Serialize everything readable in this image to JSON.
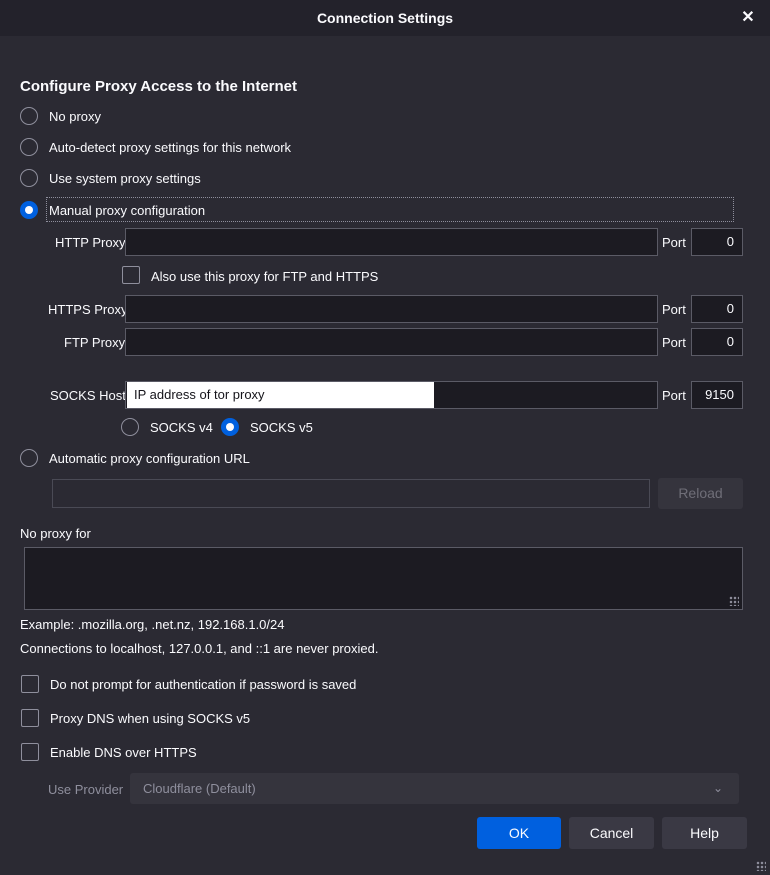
{
  "window": {
    "title": "Connection Settings",
    "close_glyph": "✕"
  },
  "section_heading": "Configure Proxy Access to the Internet",
  "proxy_modes": {
    "no_proxy": "No proxy",
    "auto_detect": "Auto-detect proxy settings for this network",
    "system": "Use system proxy settings",
    "manual": "Manual proxy configuration",
    "auto_url": "Automatic proxy configuration URL",
    "selected": "manual"
  },
  "manual": {
    "http_label": "HTTP Proxy",
    "http_value": "",
    "http_port_label": "Port",
    "http_port": "0",
    "also_use_label": "Also use this proxy for FTP and HTTPS",
    "https_label": "HTTPS Proxy",
    "https_value": "",
    "https_port_label": "Port",
    "https_port": "0",
    "ftp_label": "FTP Proxy",
    "ftp_value": "",
    "ftp_port_label": "Port",
    "ftp_port": "0",
    "socks_label": "SOCKS Host",
    "socks_value": "IP address of tor proxy",
    "socks_port_label": "Port",
    "socks_port": "9150",
    "socks_v4": "SOCKS v4",
    "socks_v5": "SOCKS v5",
    "socks_selected": "v5"
  },
  "auto_url": {
    "value": "",
    "reload_label": "Reload"
  },
  "no_proxy_for": {
    "label": "No proxy for",
    "value": "",
    "example": "Example: .mozilla.org, .net.nz, 192.168.1.0/24",
    "note": "Connections to localhost, 127.0.0.1, and ::1 are never proxied."
  },
  "options": {
    "no_prompt_auth": "Do not prompt for authentication if password is saved",
    "proxy_dns": "Proxy DNS when using SOCKS v5",
    "dns_over_https": "Enable DNS over HTTPS"
  },
  "provider": {
    "label": "Use Provider",
    "value": "Cloudflare (Default)"
  },
  "buttons": {
    "ok": "OK",
    "cancel": "Cancel",
    "help": "Help"
  },
  "colors": {
    "accent": "#0060df",
    "background": "#2b2a33",
    "field": "#1c1b22"
  }
}
